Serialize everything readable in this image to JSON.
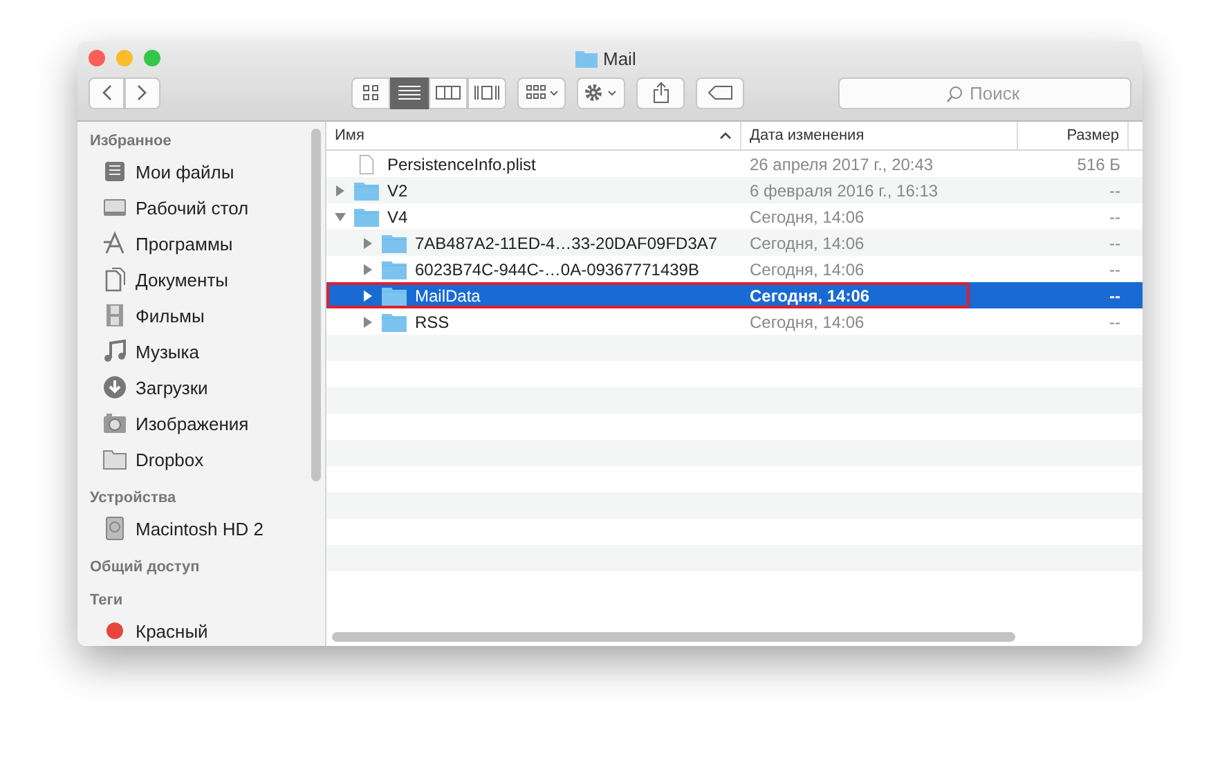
{
  "window": {
    "title": "Mail"
  },
  "toolbar": {
    "view_modes": [
      {
        "kind": "icons",
        "selected": false
      },
      {
        "kind": "list",
        "selected": true
      },
      {
        "kind": "columns",
        "selected": false
      },
      {
        "kind": "coverflow",
        "selected": false
      }
    ],
    "search": {
      "placeholder": "Поиск"
    }
  },
  "sidebar": {
    "sections": [
      {
        "title": "Избранное",
        "items": [
          {
            "kind": "files",
            "label": "Мои файлы"
          },
          {
            "kind": "desktop",
            "label": "Рабочий стол"
          },
          {
            "kind": "apps",
            "label": "Программы"
          },
          {
            "kind": "docs",
            "label": "Документы"
          },
          {
            "kind": "movies",
            "label": "Фильмы"
          },
          {
            "kind": "music",
            "label": "Музыка"
          },
          {
            "kind": "downloads",
            "label": "Загрузки"
          },
          {
            "kind": "pictures",
            "label": "Изображения"
          },
          {
            "kind": "folder",
            "label": "Dropbox"
          }
        ]
      },
      {
        "title": "Устройства",
        "items": [
          {
            "kind": "disk",
            "label": "Macintosh HD 2"
          }
        ]
      },
      {
        "title": "Общий доступ"
      },
      {
        "title": "Теги",
        "items": [
          {
            "kind": "tag",
            "label": "Красный",
            "color": "#e8453c"
          }
        ]
      }
    ]
  },
  "table": {
    "columns": [
      {
        "label": "Имя",
        "sorted": true
      },
      {
        "label": "Дата изменения",
        "sorted": false
      },
      {
        "label": "Размер",
        "sorted": false
      }
    ],
    "rows": [
      {
        "kind": "file",
        "name": "PersistenceInfo.plist",
        "date": "26 апреля 2017 г., 20:43",
        "size": "516 Б",
        "selected": false
      },
      {
        "kind": "folder",
        "name": "V2",
        "date": "6 февраля 2016 г., 16:13",
        "size": "--",
        "selected": false,
        "expanded": false
      },
      {
        "kind": "folder",
        "name": "V4",
        "date": "Сегодня, 14:06",
        "size": "--",
        "selected": false,
        "expanded": true,
        "children": [
          {
            "kind": "folder",
            "name": "7AB487A2-11ED-4…33-20DAF09FD3A7",
            "date": "Сегодня, 14:06",
            "size": "--",
            "selected": false,
            "expanded": false
          },
          {
            "kind": "folder",
            "name": "6023B74C-944C-…0A-09367771439B",
            "date": "Сегодня, 14:06",
            "size": "--",
            "selected": false,
            "expanded": false
          },
          {
            "kind": "folder",
            "name": "MailData",
            "date": "Сегодня, 14:06",
            "size": "--",
            "selected": true,
            "expanded": false,
            "highlighted": true
          },
          {
            "kind": "folder",
            "name": "RSS",
            "date": "Сегодня, 14:06",
            "size": "--",
            "selected": false,
            "expanded": false
          }
        ]
      }
    ]
  }
}
